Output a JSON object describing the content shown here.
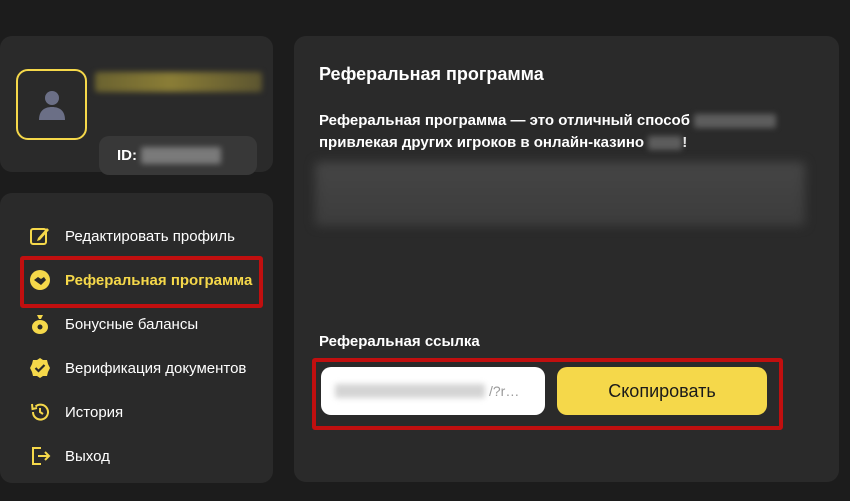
{
  "profile": {
    "id_label": "ID:"
  },
  "sidebar": {
    "items": [
      {
        "label": "Редактировать профиль",
        "icon": "edit-icon"
      },
      {
        "label": "Реферальная программа",
        "icon": "referral-handshake-icon",
        "active": true
      },
      {
        "label": "Бонусные балансы",
        "icon": "money-bag-icon"
      },
      {
        "label": "Верификация документов",
        "icon": "verified-badge-icon"
      },
      {
        "label": "История",
        "icon": "history-icon"
      },
      {
        "label": "Выход",
        "icon": "logout-icon"
      }
    ]
  },
  "main": {
    "title": "Реферальная программа",
    "desc_part1": "Реферальная программа — это отличный способ",
    "desc_part2": "привлекая других игроков в онлайн-казино",
    "desc_end": "!",
    "link_label": "Реферальная ссылка",
    "link_value_suffix": "/?r…",
    "copy_label": "Скопировать"
  },
  "colors": {
    "accent": "#f5d84a",
    "highlight": "#c10f0f",
    "panel": "#2a2a2a",
    "background": "#1c1c1c"
  }
}
